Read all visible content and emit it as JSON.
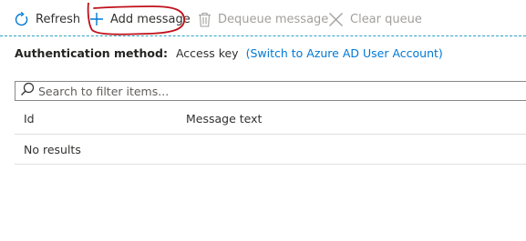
{
  "toolbar": {
    "refresh": {
      "label": "Refresh",
      "icon": "refresh-icon"
    },
    "add_message": {
      "label": "Add message",
      "icon": "plus-icon"
    },
    "dequeue_message": {
      "label": "Dequeue message",
      "icon": "trash-icon",
      "disabled": true
    },
    "clear_queue": {
      "label": "Clear queue",
      "icon": "close-icon",
      "disabled": true
    }
  },
  "auth": {
    "label": "Authentication method:",
    "value": "Access key",
    "switch_link": "(Switch to Azure AD User Account)"
  },
  "search": {
    "placeholder": "Search to filter items...",
    "value": ""
  },
  "table": {
    "columns": [
      "Id",
      "Message text"
    ],
    "rows": [],
    "empty_text": "No results"
  },
  "colors": {
    "accent": "#0078d4",
    "annotation": "#c0101a",
    "divider": "#2aa3c8",
    "disabled": "#a19f9d"
  }
}
